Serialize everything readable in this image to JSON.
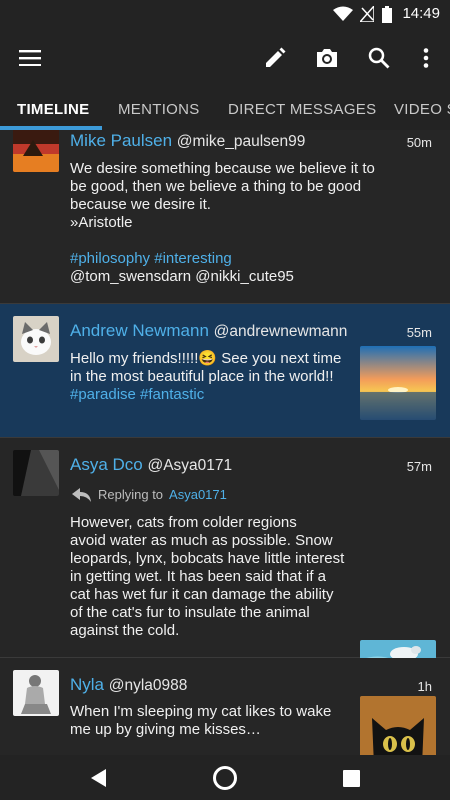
{
  "status_bar": {
    "time": "14:49"
  },
  "tabs": [
    {
      "label": "TIMELINE"
    },
    {
      "label": "MENTIONS"
    },
    {
      "label": "DIRECT MESSAGES"
    },
    {
      "label": "VIDEO S"
    }
  ],
  "tweets": [
    {
      "name": "Mike Paulsen",
      "handle": "@mike_paulsen99",
      "time": "50m",
      "lines": [
        "We desire something because we believe it to",
        "be good, then we believe a thing to be good",
        "because we desire it.",
        "»Aristotle"
      ],
      "hashtags": "#philosophy #interesting",
      "mentions": "@tom_swensdarn @nikki_cute95"
    },
    {
      "name": "Andrew Newmann",
      "handle": "@andrewnewmann",
      "time": "55m",
      "lines": [
        "Hello my friends!!!!!😆 See you next time",
        "in the most beautiful place in the world!!"
      ],
      "hashtags": "#paradise #fantastic"
    },
    {
      "name": "Asya Dco",
      "handle": "@Asya0171",
      "time": "57m",
      "reply_prefix": "Replying to",
      "reply_to": "Asya0171",
      "lines": [
        "However, cats from colder regions",
        "avoid water as much as possible. Snow",
        "leopards, lynx, bobcats have little interest",
        "in getting wet. It has been said that if a",
        "cat has wet fur it can damage the ability",
        "of the cat's fur to insulate the animal",
        "against the cold."
      ]
    },
    {
      "name": "Nyla",
      "handle": "@nyla0988",
      "time": "1h",
      "lines": [
        "When I'm sleeping my cat likes to wake",
        "me up by giving me kisses…"
      ]
    }
  ],
  "colors": {
    "accent": "#4fb0e8",
    "highlight_row": "#18395a",
    "background": "#232323"
  },
  "icons": [
    "menu-icon",
    "pencil-icon",
    "camera-icon",
    "search-icon",
    "more-vert-icon",
    "reply-icon",
    "back-icon",
    "home-icon",
    "recents-icon"
  ]
}
